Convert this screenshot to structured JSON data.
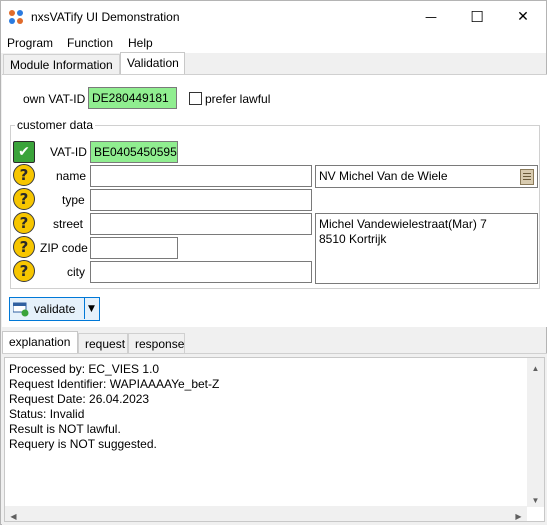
{
  "window": {
    "title": "nxsVATify UI Demonstration",
    "minimize_glyph": "—",
    "maximize_glyph": "☐",
    "close_glyph": "✕"
  },
  "menu": {
    "items": [
      "Program",
      "Function",
      "Help"
    ]
  },
  "tabs": {
    "items": [
      "Module Information",
      "Validation"
    ],
    "active": "Validation"
  },
  "validation": {
    "own_vat_label": "own VAT-ID",
    "own_vat_value": "DE280449181",
    "prefer_lawful_label": "prefer lawful",
    "prefer_lawful_checked": false,
    "customer_group_title": "customer data",
    "vat_label": "VAT-ID",
    "vat_value": "BE0405450595",
    "vat_status": "valid",
    "name_label": "name",
    "name_value": "",
    "type_label": "type",
    "type_value": "",
    "street_label": "street",
    "street_value": "",
    "zip_label": "ZIP code",
    "zip_value": "",
    "city_label": "city",
    "city_value": "",
    "field_status": "unknown",
    "result_name": "NV Michel Van de Wiele",
    "result_address_line1": "Michel Vandewielestraat(Mar) 7",
    "result_address_line2": "8510 Kortrijk",
    "validate_label": "validate",
    "colors": {
      "valid_field": "#90ee90",
      "status_ok": "#3aa33a",
      "status_unknown": "#f7c600",
      "focus_accent": "#0078d7"
    }
  },
  "lower_tabs": {
    "items": [
      "explanation",
      "request",
      "response"
    ],
    "active": "explanation"
  },
  "explanation": {
    "lines": [
      "Processed by: EC_VIES 1.0",
      "Request Identifier: WAPIAAAAYe_bet-Z",
      "Request Date: 26.04.2023",
      "Status: Invalid",
      "Result is NOT lawful.",
      "Requery is NOT suggested."
    ]
  }
}
